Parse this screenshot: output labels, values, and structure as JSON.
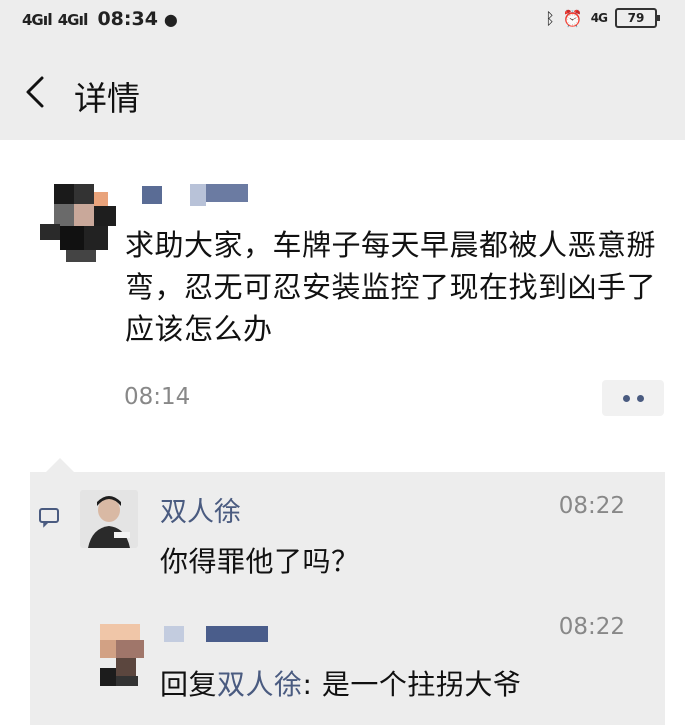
{
  "status_bar": {
    "network1": "4G",
    "network2": "4G",
    "time": "08:34",
    "right_network": "4G",
    "battery": "79",
    "icons": [
      "signal-icon",
      "wechat-icon",
      "bluetooth-icon",
      "alarm-icon",
      "battery-icon"
    ]
  },
  "header": {
    "back_icon": "chevron-left-icon",
    "title": "详情"
  },
  "post": {
    "text": "求助大家，车牌子每天早晨都被人恶意掰弯，忍无可忍安装监控了现在找到凶手了应该怎么办",
    "time": "08:14",
    "more_icon": "more-dots-icon"
  },
  "comments": [
    {
      "name": "双人徐",
      "time": "08:22",
      "text": "你得罪他了吗？"
    },
    {
      "time": "08:22",
      "reply_prefix": "回复",
      "reply_to": "双人徐",
      "text": ": 是一个拄拐大爷"
    }
  ],
  "colors": {
    "link_blue": "#4a5b80",
    "bg_gray": "#ededed",
    "time_gray": "#888888"
  }
}
